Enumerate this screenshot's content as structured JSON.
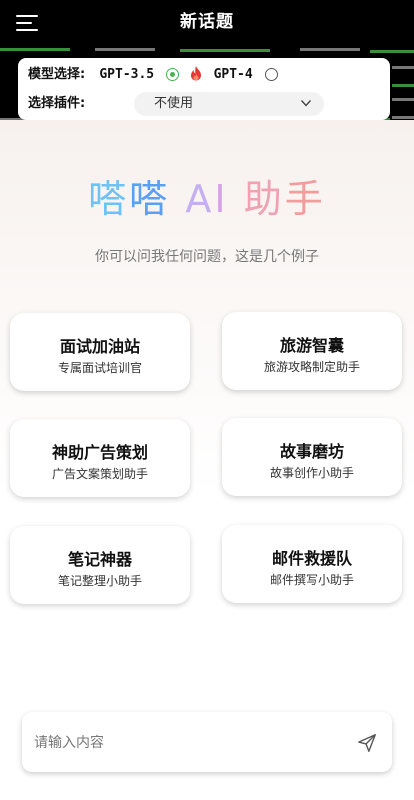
{
  "header": {
    "title": "新话题"
  },
  "settings": {
    "model_label": "模型选择:",
    "model_options": [
      {
        "label": "GPT-3.5",
        "selected": true
      },
      {
        "label": "GPT-4",
        "selected": false
      }
    ],
    "plugin_label": "选择插件:",
    "plugin_value": "不使用"
  },
  "hero": {
    "brand_chars": [
      "嗒",
      "嗒",
      "A",
      "I",
      "助",
      "手"
    ],
    "subtitle": "你可以问我任何问题，这是几个例子"
  },
  "examples": [
    {
      "title": "面试加油站",
      "subtitle": "专属面试培训官"
    },
    {
      "title": "旅游智囊",
      "subtitle": "旅游攻略制定助手"
    },
    {
      "title": "神助广告策划",
      "subtitle": "广告文案策划助手"
    },
    {
      "title": "故事磨坊",
      "subtitle": "故事创作小助手"
    },
    {
      "title": "笔记神器",
      "subtitle": "笔记整理小助手"
    },
    {
      "title": "邮件救援队",
      "subtitle": "邮件撰写小助手"
    }
  ],
  "input": {
    "placeholder": "请输入内容"
  },
  "colors": {
    "accent_green": "#4caf50",
    "fire": "#e53935",
    "topbar": "#000000"
  }
}
